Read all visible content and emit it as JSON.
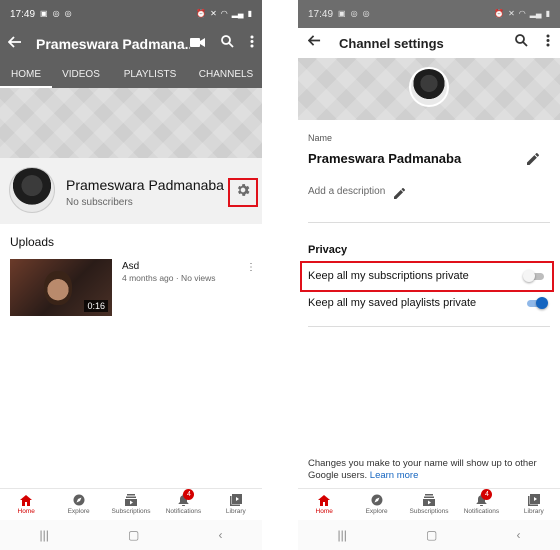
{
  "left": {
    "status": {
      "time": "17:49",
      "icons": [
        "image-icon",
        "whatsapp-icon",
        "whatsapp-icon"
      ]
    },
    "appbar": {
      "title": "Prameswara Padmana..."
    },
    "tabs": [
      "HOME",
      "VIDEOS",
      "PLAYLISTS",
      "CHANNELS"
    ],
    "channel": {
      "name": "Prameswara Padmanaba",
      "subscribers": "No subscribers"
    },
    "uploads_heading": "Uploads",
    "video": {
      "title": "Asd",
      "meta": "4 months ago · No views",
      "duration": "0:16"
    }
  },
  "right": {
    "status": {
      "time": "17:49"
    },
    "appbar": {
      "title": "Channel settings"
    },
    "name_label": "Name",
    "name_value": "Prameswara Padmanaba",
    "description_placeholder": "Add a description",
    "privacy_heading": "Privacy",
    "settings": [
      {
        "label": "Keep all my subscriptions private",
        "on": false
      },
      {
        "label": "Keep all my saved playlists private",
        "on": true
      }
    ],
    "footer_text": "Changes you make to your name will show up to other Google users.",
    "footer_link": "Learn more"
  },
  "bottom_nav": {
    "items": [
      {
        "label": "Home",
        "icon": "home-icon"
      },
      {
        "label": "Explore",
        "icon": "compass-icon"
      },
      {
        "label": "Subscriptions",
        "icon": "subscriptions-icon"
      },
      {
        "label": "Notifications",
        "icon": "bell-icon",
        "badge": "4"
      },
      {
        "label": "Library",
        "icon": "library-icon"
      }
    ],
    "active": "Home"
  },
  "colors": {
    "accent_red": "#d40000",
    "toggle_blue": "#1565c0",
    "highlight_red": "#e0101a"
  }
}
